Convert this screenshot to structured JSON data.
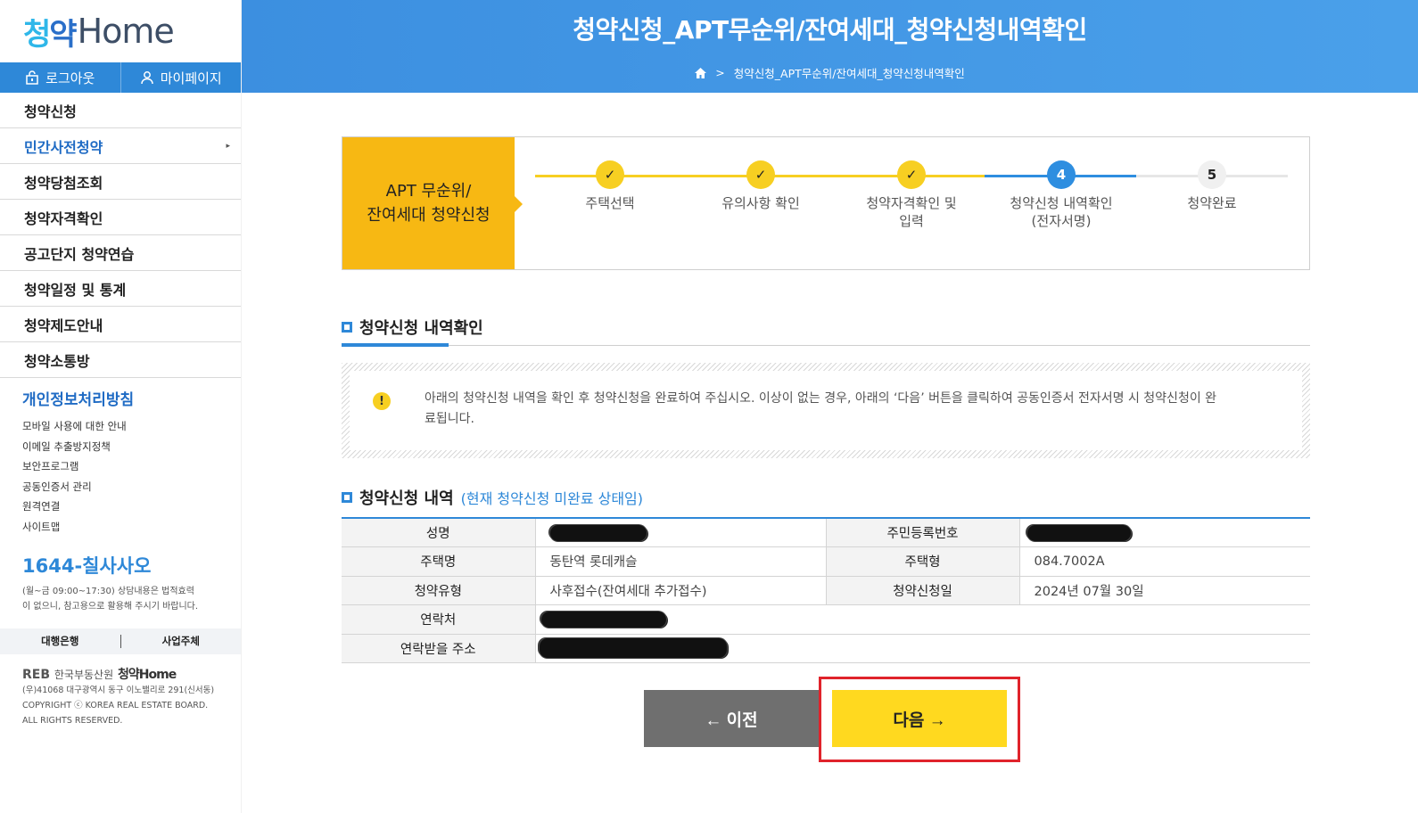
{
  "brand": {
    "logo_ko": "청약",
    "logo_en": "Home"
  },
  "auth": {
    "logout_label": "로그아웃",
    "mypage_label": "마이페이지"
  },
  "menu": [
    {
      "label": "청약신청"
    },
    {
      "label": "민간사전청약",
      "arrow": "▸"
    },
    {
      "label": "청약당첨조회"
    },
    {
      "label": "청약자격확인"
    },
    {
      "label": "공고단지 청약연습"
    },
    {
      "label": "청약일정 및 통계"
    },
    {
      "label": "청약제도안내"
    },
    {
      "label": "청약소통방"
    }
  ],
  "privacy": {
    "title": "개인정보처리방침",
    "links": [
      "모바일 사용에 대한 안내",
      "이메일 추출방지정책",
      "보안프로그램",
      "공동인증서 관리",
      "원격연결",
      "사이트맵"
    ]
  },
  "callcenter": {
    "phone_prefix": "1644-",
    "phone_name": "칠사사오",
    "note": "(월~금 09:00~17:30) 상담내용은 법적효력이 없으니, 참고용으로 활용해 주시기 바랍니다."
  },
  "partners": {
    "bank": "대행은행",
    "business": "사업주체"
  },
  "footer": {
    "org": "한국부동산원",
    "logo_mark": "REB",
    "service": "청약Home",
    "address": "(우)41068 대구광역시 동구 이노밸리로 291(신서동)",
    "copyright": "COPYRIGHT ⓒ KOREA REAL ESTATE BOARD.",
    "rights": "ALL RIGHTS RESERVED."
  },
  "header": {
    "title": "청약신청_APT무순위/잔여세대_청약신청내역확인",
    "breadcrumb": "청약신청_APT무순위/잔여세대_청약신청내역확인"
  },
  "steps": {
    "title_line1": "APT 무순위/",
    "title_line2": "잔여세대 청약신청",
    "items": [
      {
        "num": "✓",
        "label": "주택선택",
        "status": "done"
      },
      {
        "num": "✓",
        "label": "유의사항 확인",
        "status": "done"
      },
      {
        "num": "✓",
        "label": "청약자격확인 및\n입력",
        "status": "done"
      },
      {
        "num": "4",
        "label": "청약신청 내역확인\n(전자서명)",
        "status": "current"
      },
      {
        "num": "5",
        "label": "청약완료",
        "status": "todo"
      }
    ]
  },
  "confirm_section": {
    "title": "청약신청 내역확인"
  },
  "notice": {
    "icon": "!",
    "text": "아래의 청약신청 내역을 확인 후 청약신청을 완료하여 주십시오. 이상이 없는 경우, 아래의 ‘다음’ 버튼을 클릭하여 공동인증서 전자서명 시 청약신청이 완료됩니다."
  },
  "detail_section": {
    "title": "청약신청 내역",
    "status_note": "(현재 청약신청 미완료 상태임)"
  },
  "table": {
    "name_label": "성명",
    "rrn_label": "주민등록번호",
    "house_label": "주택명",
    "house_value": "동탄역 롯데캐슬",
    "type_label": "주택형",
    "type_value": "084.7002A",
    "apply_type_label": "청약유형",
    "apply_type_value": "사후접수(잔여세대 추가접수)",
    "apply_date_label": "청약신청일",
    "apply_date_value": "2024년 07월 30일",
    "contact_label": "연락처",
    "address_label": "연락받을 주소"
  },
  "buttons": {
    "prev_label": "← 이전",
    "next_label": "다음 →"
  },
  "colors": {
    "primary": "#2e88d8",
    "accent_yellow": "#f7b813",
    "next_button": "#ffd91f",
    "prev_button": "#6f6f6f",
    "highlight_box": "#e0232b"
  }
}
